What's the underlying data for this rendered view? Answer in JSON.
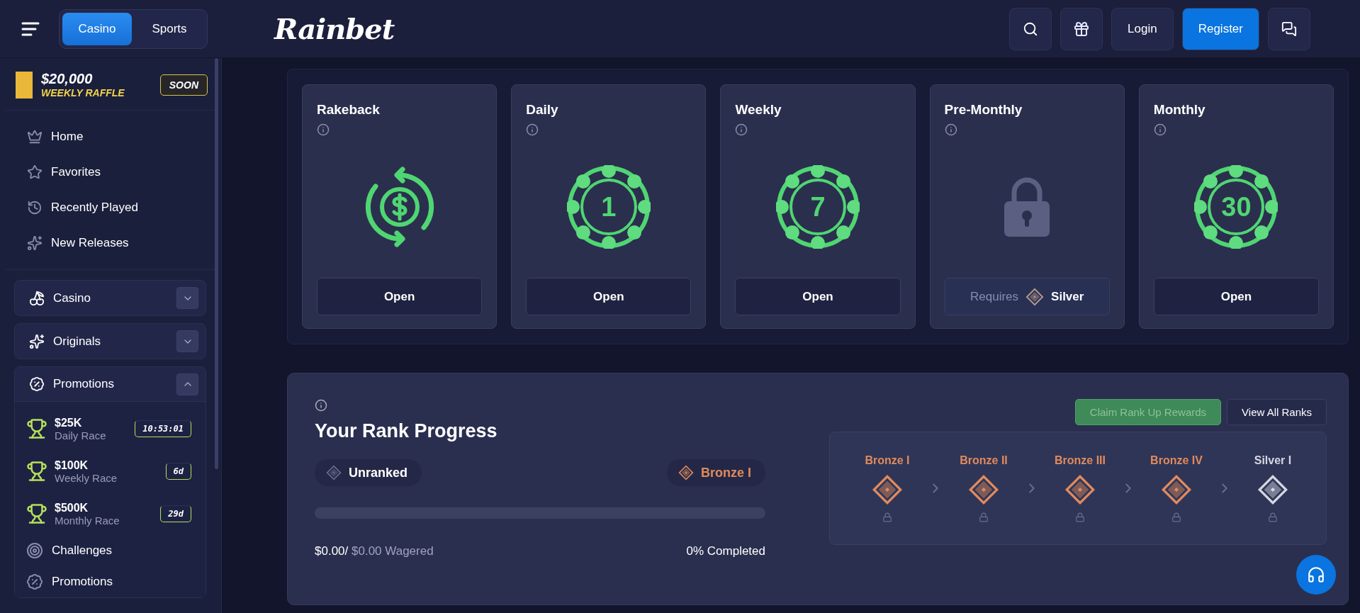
{
  "header": {
    "tabs": [
      {
        "label": "Casino",
        "selected": true
      },
      {
        "label": "Sports",
        "selected": false
      }
    ],
    "logo": "Rainbet",
    "login": "Login",
    "register": "Register"
  },
  "raffle": {
    "amount": "$20,000",
    "label": "WEEKLY RAFFLE",
    "badge": "SOON"
  },
  "nav": [
    {
      "label": "Home"
    },
    {
      "label": "Favorites"
    },
    {
      "label": "Recently Played"
    },
    {
      "label": "New Releases"
    }
  ],
  "sections": [
    {
      "label": "Casino",
      "expanded": false
    },
    {
      "label": "Originals",
      "expanded": false
    },
    {
      "label": "Promotions",
      "expanded": true,
      "children": [
        {
          "kind": "race",
          "amount": "$25K",
          "name": "Daily Race",
          "timer": "10:53:01"
        },
        {
          "kind": "race",
          "amount": "$100K",
          "name": "Weekly Race",
          "timer": "6d"
        },
        {
          "kind": "race",
          "amount": "$500K",
          "name": "Monthly Race",
          "timer": "29d"
        },
        {
          "kind": "link",
          "label": "Challenges"
        },
        {
          "kind": "link",
          "label": "Promotions"
        }
      ]
    }
  ],
  "cards": [
    {
      "title": "Rakeback",
      "kind": "rakeback",
      "button": "Open"
    },
    {
      "title": "Daily",
      "kind": "chip",
      "number": "1",
      "button": "Open"
    },
    {
      "title": "Weekly",
      "kind": "chip",
      "number": "7",
      "button": "Open"
    },
    {
      "title": "Pre-Monthly",
      "kind": "locked",
      "requires": "Requires",
      "tier": "Silver"
    },
    {
      "title": "Monthly",
      "kind": "chip",
      "number": "30",
      "button": "Open"
    }
  ],
  "rank": {
    "title": "Your Rank Progress",
    "current": "Unranked",
    "next": "Bronze I",
    "level": 0,
    "wagered": "$0.00/",
    "target": "$0.00",
    "wagered_label": "Wagered",
    "completed": "0% Completed",
    "claim": {
      "label": "Claim Rank Up Rewards",
      "disabled": true
    },
    "view_all": "View All Ranks",
    "tiers": [
      {
        "name": "Bronze I",
        "color": "#e08a5c",
        "locked": true
      },
      {
        "name": "Bronze II",
        "color": "#e08a5c",
        "locked": true
      },
      {
        "name": "Bronze III",
        "color": "#e08a5c",
        "locked": true
      },
      {
        "name": "Bronze IV",
        "color": "#e08a5c",
        "locked": true
      },
      {
        "name": "Silver I",
        "color": "#d4d6e0",
        "locked": true
      }
    ]
  }
}
